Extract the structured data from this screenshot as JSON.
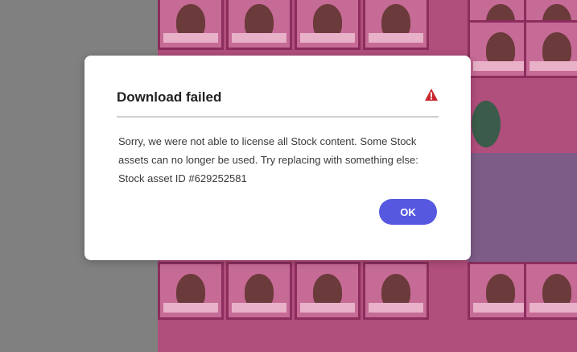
{
  "dialog": {
    "title": "Download failed",
    "icon": "alert-triangle-icon",
    "message_lines": [
      "Sorry, we were not able to license all Stock content. Some Stock",
      "assets can no longer be used. Try replacing with something else:",
      "Stock asset ID #629252581"
    ],
    "ok_label": "OK"
  },
  "colors": {
    "primary_button": "#5659E0",
    "alert_icon": "#C9252D",
    "overlay_left": "#808080",
    "backdrop": "#B04E7C"
  }
}
